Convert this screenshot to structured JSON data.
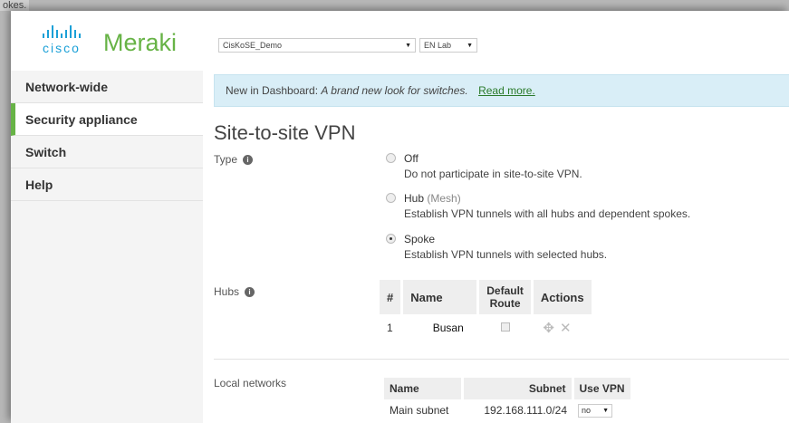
{
  "backdrop_text": "okes.",
  "brand": {
    "cisco": "cisco",
    "meraki": "Meraki"
  },
  "selectors": {
    "organization": "CisKoSE_Demo",
    "network": "EN Lab"
  },
  "sidebar": {
    "items": [
      {
        "label": "Network-wide"
      },
      {
        "label": "Security appliance",
        "active": true
      },
      {
        "label": "Switch"
      },
      {
        "label": "Help"
      }
    ]
  },
  "banner": {
    "prefix": "New in Dashboard:",
    "message": "A brand new look for switches.",
    "link": "Read more."
  },
  "page": {
    "title": "Site-to-site VPN",
    "type_label": "Type",
    "hubs_label": "Hubs",
    "local_networks_label": "Local networks"
  },
  "vpn_type": {
    "options": [
      {
        "title": "Off",
        "sub": "",
        "desc": "Do not participate in site-to-site VPN.",
        "checked": false
      },
      {
        "title": "Hub",
        "sub": "(Mesh)",
        "desc": "Establish VPN tunnels with all hubs and dependent spokes.",
        "checked": false
      },
      {
        "title": "Spoke",
        "sub": "",
        "desc": "Establish VPN tunnels with selected hubs.",
        "checked": true
      }
    ]
  },
  "hubs_table": {
    "headers": {
      "num": "#",
      "name": "Name",
      "default_route_1": "Default",
      "default_route_2": "Route",
      "actions": "Actions"
    },
    "rows": [
      {
        "num": "1",
        "name": "Busan"
      }
    ]
  },
  "local_networks_table": {
    "headers": {
      "name": "Name",
      "subnet": "Subnet",
      "use_vpn": "Use VPN"
    },
    "rows": [
      {
        "name": "Main subnet",
        "subnet": "192.168.111.0/24",
        "use_vpn": "no"
      }
    ]
  },
  "colors": {
    "cisco_blue": "#1ba0d7",
    "meraki_green": "#67b346",
    "banner_bg": "#d9eef7"
  }
}
